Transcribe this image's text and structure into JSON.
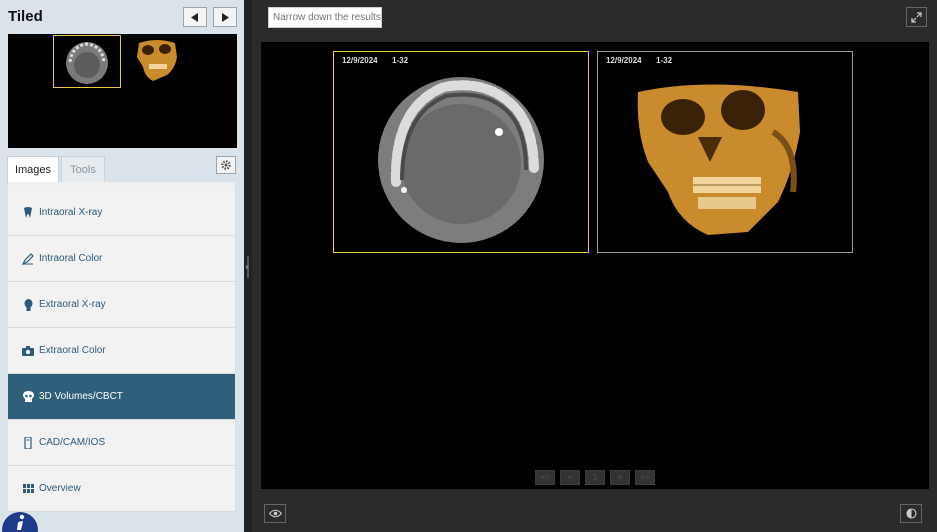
{
  "sidebar": {
    "title": "Tiled",
    "tabs": [
      {
        "label": "Images",
        "active": true
      },
      {
        "label": "Tools",
        "active": false
      }
    ],
    "items": [
      {
        "label": "Intraoral X-ray",
        "icon": "tooth-icon"
      },
      {
        "label": "Intraoral Color",
        "icon": "pen-icon"
      },
      {
        "label": "Extraoral X-ray",
        "icon": "head-icon"
      },
      {
        "label": "Extraoral Color",
        "icon": "camera-icon"
      },
      {
        "label": "3D Volumes/CBCT",
        "icon": "skull-icon",
        "active": true
      },
      {
        "label": "CAD/CAM/IOS",
        "icon": "scanner-icon"
      },
      {
        "label": "Overview",
        "icon": "grid-icon"
      }
    ]
  },
  "viewer": {
    "search_placeholder": "Narrow down the results",
    "tiles": [
      {
        "date": "12/9/2024",
        "range": "1-32",
        "selected": true
      },
      {
        "date": "12/9/2024",
        "range": "1-32",
        "selected": false
      }
    ],
    "pager": [
      "<<",
      "<",
      "1",
      ">",
      ">>"
    ]
  },
  "colors": {
    "accent_active": "#2f5f7a",
    "selection": "#e8c64a",
    "link_text": "#2e5a78"
  }
}
